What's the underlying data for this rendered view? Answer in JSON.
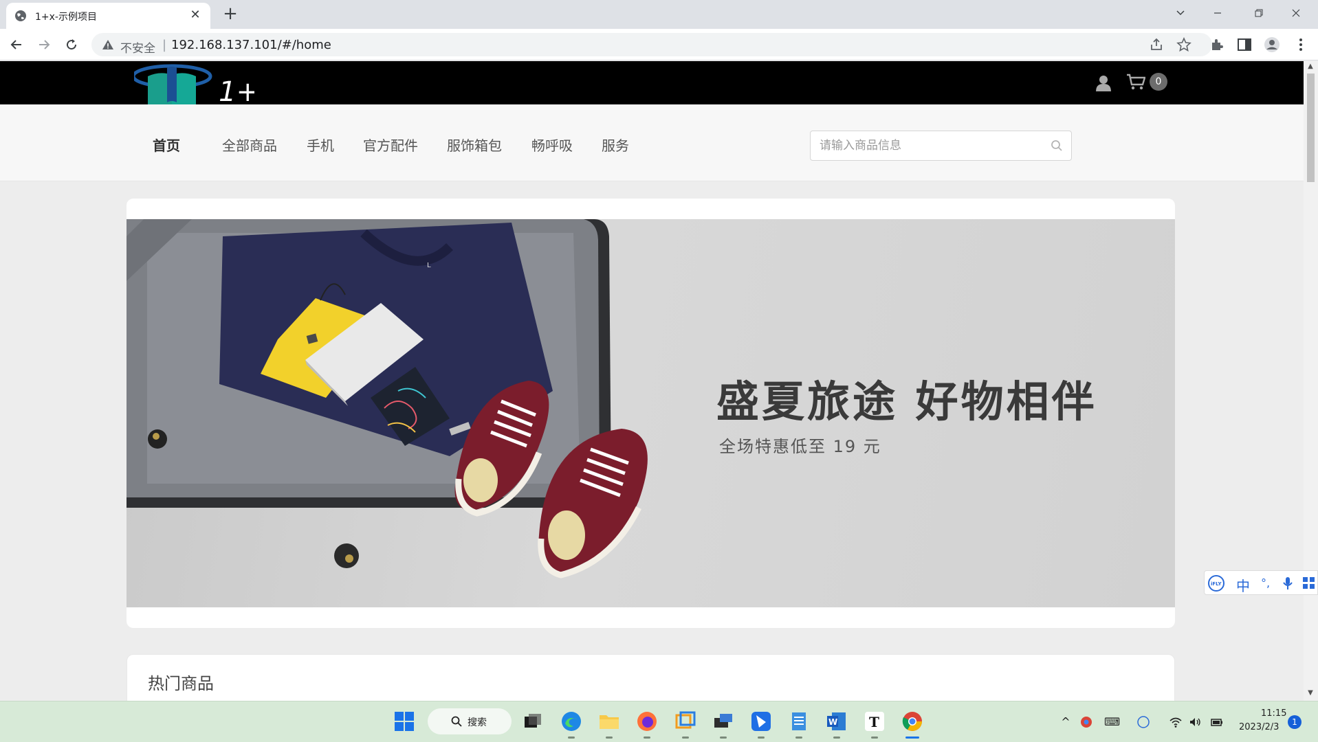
{
  "browser": {
    "tab_title": "1+x-示例项目",
    "tab_close": "✕",
    "new_tab": "+",
    "url_security": "不安全",
    "url": "192.168.137.101/#/home"
  },
  "site": {
    "logo_text": "1+",
    "cart_count": "0",
    "nav": [
      {
        "label": "首页",
        "active": true
      },
      {
        "label": "全部商品"
      },
      {
        "label": "手机"
      },
      {
        "label": "官方配件"
      },
      {
        "label": "服饰箱包"
      },
      {
        "label": "畅呼吸"
      },
      {
        "label": "服务"
      }
    ],
    "search_placeholder": "请输入商品信息",
    "banner": {
      "headline": "盛夏旅途 好物相伴",
      "subtitle": "全场特惠低至 19 元"
    },
    "hot_title": "热门商品"
  },
  "ime": {
    "brand": "iFLY",
    "mode": "中",
    "punct": "°,"
  },
  "taskbar": {
    "search_label": "搜索",
    "time": "11:15",
    "date": "2023/2/3",
    "notifications": "1"
  },
  "colors": {
    "header_bg": "#000000",
    "nav_bg": "#f7f7f7",
    "page_bg": "#ededed",
    "taskbar_bg": "#d7ead7"
  }
}
